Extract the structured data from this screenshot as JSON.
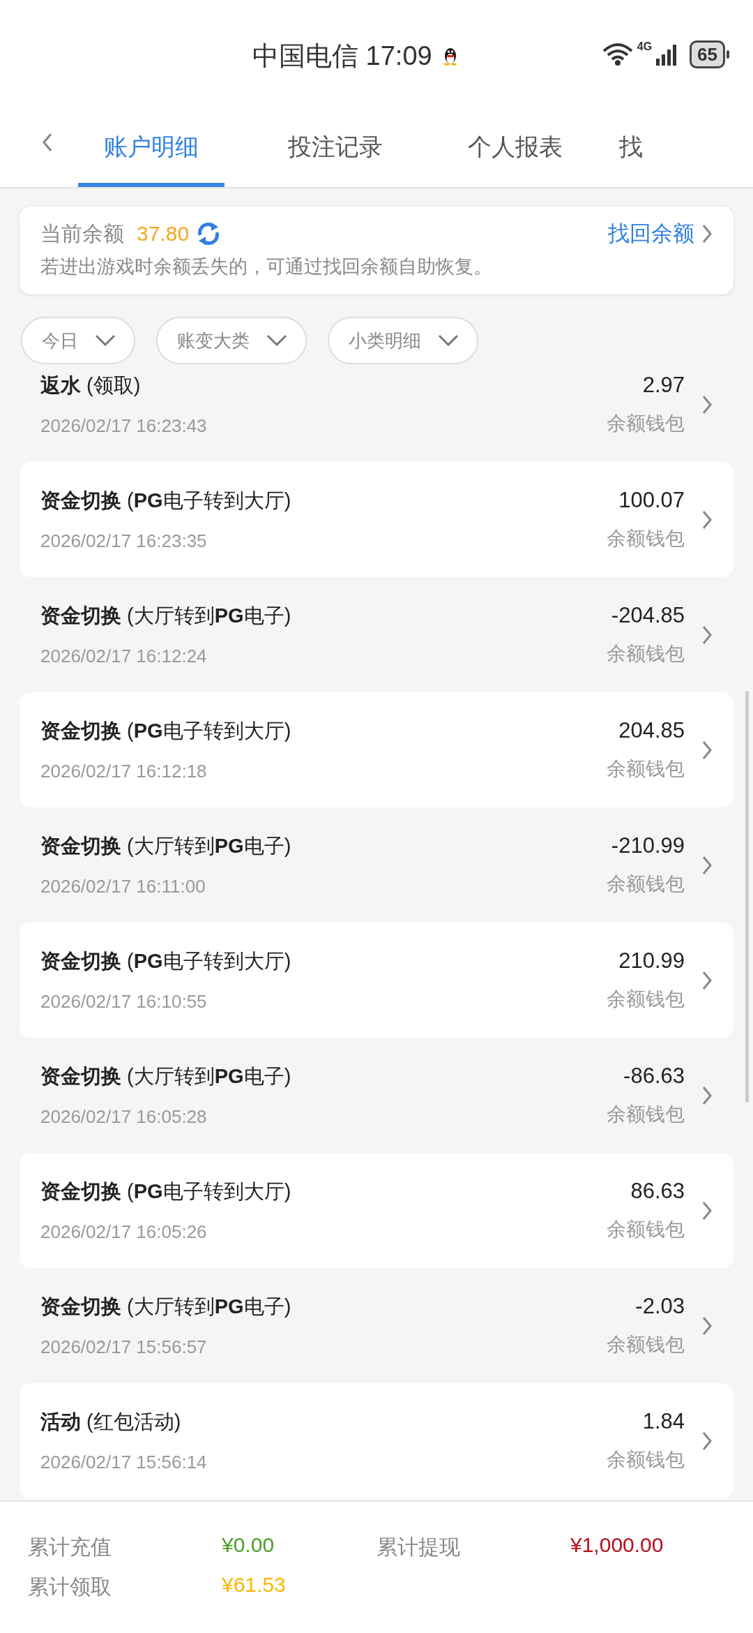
{
  "status_bar": {
    "carrier_time": "中国电信 17:09",
    "network": "4G",
    "battery": "65"
  },
  "tabs": [
    {
      "label": "账户明细",
      "selected": true
    },
    {
      "label": "投注记录",
      "selected": false
    },
    {
      "label": "个人报表",
      "selected": false
    },
    {
      "label": "找",
      "selected": false
    }
  ],
  "balance_card": {
    "label": "当前余额",
    "amount": "37.80",
    "recover_link": "找回余额",
    "hint": "若进出游戏时余额丢失的，可通过找回余额自助恢复。"
  },
  "filters": [
    {
      "label": "今日"
    },
    {
      "label": "账变大类"
    },
    {
      "label": "小类明细"
    }
  ],
  "records": [
    {
      "title": "**返水** (领取)",
      "amount": "2.97",
      "time": "2026/02/17 16:23:43",
      "wallet": "余额钱包"
    },
    {
      "title": "**资金切换** (**PG**电子转到大厅)",
      "amount": "100.07",
      "time": "2026/02/17 16:23:35",
      "wallet": "余额钱包"
    },
    {
      "title": "**资金切换** (大厅转到**PG**电子)",
      "amount": "-204.85",
      "time": "2026/02/17 16:12:24",
      "wallet": "余额钱包"
    },
    {
      "title": "**资金切换** (**PG**电子转到大厅)",
      "amount": "204.85",
      "time": "2026/02/17 16:12:18",
      "wallet": "余额钱包"
    },
    {
      "title": "**资金切换** (大厅转到**PG**电子)",
      "amount": "-210.99",
      "time": "2026/02/17 16:11:00",
      "wallet": "余额钱包"
    },
    {
      "title": "**资金切换** (**PG**电子转到大厅)",
      "amount": "210.99",
      "time": "2026/02/17 16:10:55",
      "wallet": "余额钱包"
    },
    {
      "title": "**资金切换** (大厅转到**PG**电子)",
      "amount": "-86.63",
      "time": "2026/02/17 16:05:28",
      "wallet": "余额钱包"
    },
    {
      "title": "**资金切换** (**PG**电子转到大厅)",
      "amount": "86.63",
      "time": "2026/02/17 16:05:26",
      "wallet": "余额钱包"
    },
    {
      "title": "**资金切换** (大厅转到**PG**电子)",
      "amount": "-2.03",
      "time": "2026/02/17 15:56:57",
      "wallet": "余额钱包"
    },
    {
      "title": "**活动** (红包活动)",
      "amount": "1.84",
      "time": "2026/02/17 15:56:14",
      "wallet": "余额钱包"
    }
  ],
  "summary": [
    {
      "label": "累计充值",
      "value": "¥0.00",
      "color": "#4aa02c"
    },
    {
      "label": "累计提现",
      "value": "¥1,000.00",
      "color": "#b5121b"
    },
    {
      "label": "累计领取",
      "value": "¥61.53",
      "color": "#f5b800"
    }
  ]
}
